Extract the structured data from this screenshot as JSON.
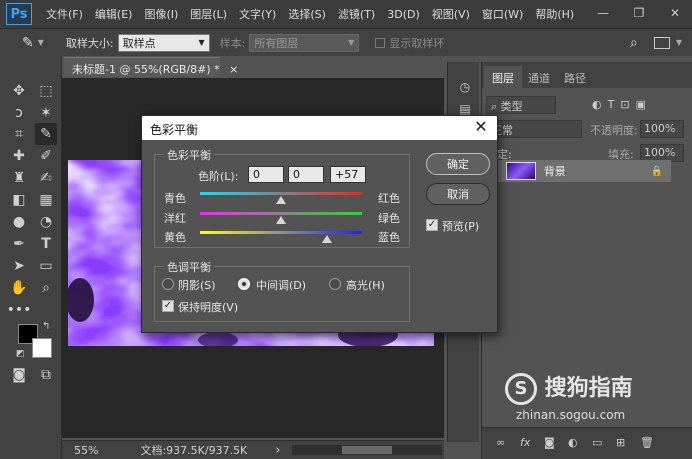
{
  "app": {
    "logo_text": "Ps",
    "menu": [
      "文件(F)",
      "编辑(E)",
      "图像(I)",
      "图层(L)",
      "文字(Y)",
      "选择(S)",
      "滤镜(T)",
      "3D(D)",
      "视图(V)",
      "窗口(W)",
      "帮助(H)"
    ],
    "window_controls": {
      "minimize": "—",
      "restore": "❐",
      "close": "✕"
    }
  },
  "options_bar": {
    "sample_size_label": "取样大小:",
    "sample_size_value": "取样点",
    "sample_label": "样本:",
    "sample_value": "所有图层",
    "show_ring_label": "显示取样环"
  },
  "document": {
    "tab_title": "未标题-1 @ 55%(RGB/8#) *",
    "tab_close": "×",
    "zoom": "55%",
    "doc_info": "文档:937.5K/937.5K",
    "status_arrow": "›"
  },
  "layers_panel": {
    "tabs": [
      "图层",
      "通道",
      "路径"
    ],
    "filter_label": "类型",
    "blend_mode": "正常",
    "opacity_label": "不透明度:",
    "opacity_value": "100%",
    "lock_label": "锁定:",
    "fill_label": "填充:",
    "fill_value": "100%",
    "layer_name": "背景"
  },
  "dialog": {
    "title": "色彩平衡",
    "close_glyph": "✕",
    "color_balance_group": "色彩平衡",
    "levels_label": "色阶(L):",
    "levels": [
      "0",
      "0",
      "+57"
    ],
    "sliders": [
      {
        "left": "青色",
        "right": "红色",
        "value": 0
      },
      {
        "left": "洋红",
        "right": "绿色",
        "value": 0
      },
      {
        "left": "黄色",
        "right": "蓝色",
        "value": 57
      }
    ],
    "tone_group": "色调平衡",
    "tones": [
      {
        "label": "阴影(S)",
        "selected": false
      },
      {
        "label": "中间调(D)",
        "selected": true
      },
      {
        "label": "高光(H)",
        "selected": false
      }
    ],
    "preserve_luminosity": "保持明度(V)",
    "ok": "确定",
    "cancel": "取消",
    "preview": "预览(P)"
  },
  "watermark": {
    "text": "搜狗指南",
    "url": "zhinan.sogou.com"
  },
  "colors": {
    "foreground": "#000000",
    "background": "#ffffff",
    "accent": "#31a8ff"
  }
}
